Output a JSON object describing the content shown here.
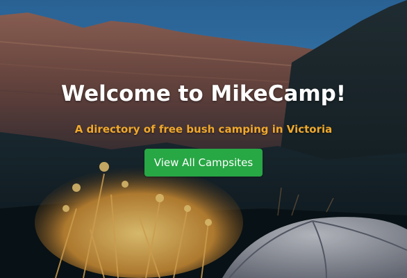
{
  "hero": {
    "title": "Welcome to MikeCamp!",
    "subtitle": "A directory of free bush camping in Victoria",
    "cta_label": "View All Campsites",
    "colors": {
      "accent": "#f0a92c",
      "button": "#28a745",
      "title": "#ffffff"
    }
  }
}
